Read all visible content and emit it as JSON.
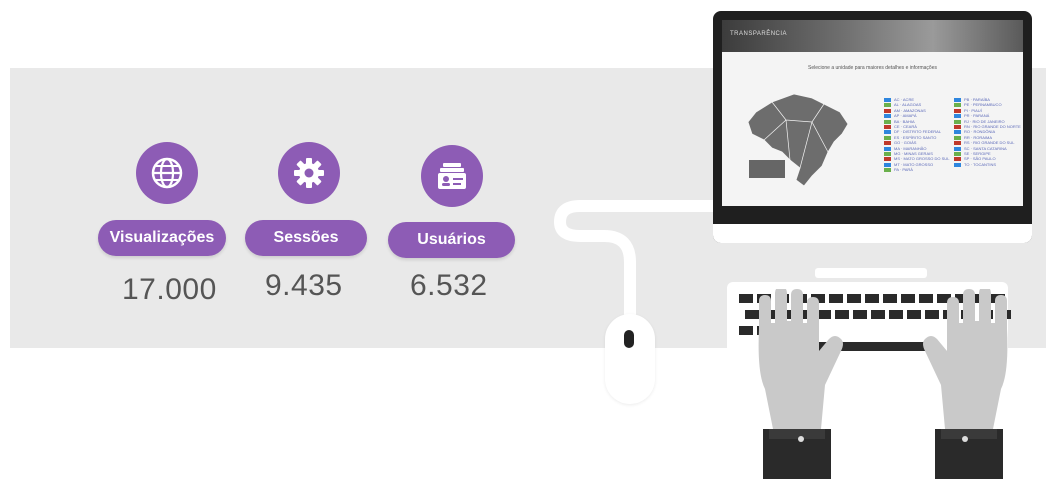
{
  "stats": [
    {
      "label": "Visualizações",
      "value": "17.000",
      "icon": "globe-icon"
    },
    {
      "label": "Sessões",
      "value": "9.435",
      "icon": "gear-icon"
    },
    {
      "label": "Usuários",
      "value": "6.532",
      "icon": "user-card-icon"
    }
  ],
  "screen": {
    "logo": "TRANSPARÊNCIA",
    "instruction": "Selecione a unidade para maiores detalhes e informações",
    "map_button": "",
    "legend_left": [
      "AC · ACRE",
      "AL · ALAGOAS",
      "AM · AMAZONAS",
      "AP · AMAPÁ",
      "BA · BAHIA",
      "CE · CEARÁ",
      "DF · DISTRITO FEDERAL",
      "ES · ESPÍRITO SANTO",
      "GO · GOIÁS",
      "MA · MARANHÃO",
      "MG · MINAS GERAIS",
      "MS · MATO GROSSO DO SUL",
      "MT · MATO GROSSO",
      "PA · PARÁ"
    ],
    "legend_right": [
      "PB · PARAÍBA",
      "PE · PERNAMBUCO",
      "PI · PIAUÍ",
      "PR · PARANÁ",
      "RJ · RIO DE JANEIRO",
      "RN · RIO GRANDE DO NORTE",
      "RO · RONDÔNIA",
      "RR · RORAIMA",
      "RS · RIO GRANDE DO SUL",
      "SC · SANTA CATARINA",
      "SE · SERGIPE",
      "SP · SÃO PAULO",
      "TO · TOCANTINS"
    ]
  },
  "colors": {
    "accent": "#8d5cb5",
    "band": "#e9e9e9",
    "text": "#555555"
  }
}
